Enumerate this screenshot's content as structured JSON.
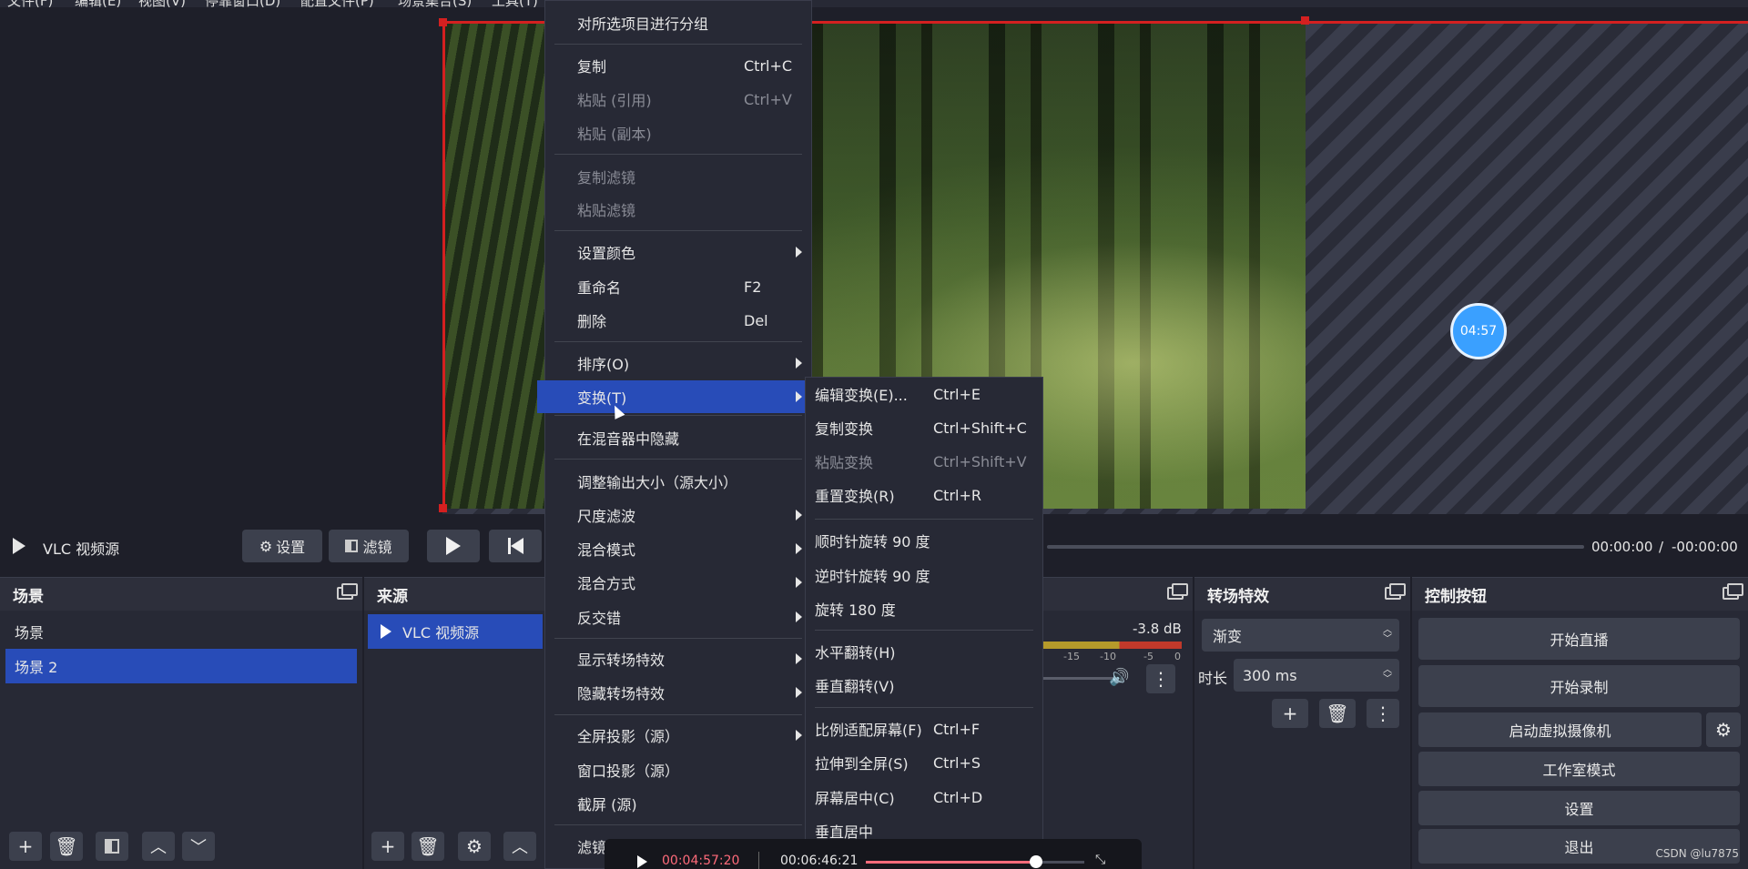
{
  "menubar": [
    "文件(F)",
    "编辑(E)",
    "视图(V)",
    "停靠窗口(D)",
    "配置文件(P)",
    "场景集合(S)",
    "工具(T)"
  ],
  "preview": {
    "timer": "04:57"
  },
  "media_controls": {
    "source_name": "VLC 视频源",
    "settings_label": "设置",
    "filters_label": "滤镜",
    "time_current": "00:00:00",
    "time_separator": "/",
    "time_remaining": "-00:00:00"
  },
  "scenes": {
    "title": "场景",
    "items": [
      "场景",
      "场景 2"
    ],
    "selected_index": 1
  },
  "sources": {
    "title": "来源",
    "items": [
      "VLC 视频源"
    ]
  },
  "mixer": {
    "db": "-3.8 dB",
    "ticks": [
      "-15",
      "-10",
      "-5",
      "0"
    ]
  },
  "transitions": {
    "title": "转场特效",
    "type": "渐变",
    "duration_label": "时长",
    "duration_value": "300 ms"
  },
  "controls": {
    "title": "控制按钮",
    "start_stream": "开始直播",
    "start_record": "开始录制",
    "virtual_cam": "启动虚拟摄像机",
    "studio_mode": "工作室模式",
    "settings": "设置",
    "exit": "退出"
  },
  "context_menu": {
    "group": "对所选项目进行分组",
    "copy": "复制",
    "copy_sc": "Ctrl+C",
    "paste_ref": "粘贴 (引用)",
    "paste_ref_sc": "Ctrl+V",
    "paste_dup": "粘贴 (副本)",
    "copy_filters": "复制滤镜",
    "paste_filters": "粘贴滤镜",
    "set_color": "设置颜色",
    "rename": "重命名",
    "rename_sc": "F2",
    "delete": "删除",
    "delete_sc": "Del",
    "order": "排序(O)",
    "transform": "变换(T)",
    "hide_in_mixer": "在混音器中隐藏",
    "resize_output": "调整输出大小（源大小）",
    "scale_filter": "尺度滤波",
    "blend_mode": "混合模式",
    "blend_method": "混合方式",
    "deinterlace": "反交错",
    "show_transition": "显示转场特效",
    "hide_transition": "隐藏转场特效",
    "fullscreen_proj": "全屏投影（源）",
    "window_proj": "窗口投影（源）",
    "screenshot": "截屏 (源)",
    "filters": "滤镜"
  },
  "transform_menu": {
    "edit": "编辑变换(E)...",
    "edit_sc": "Ctrl+E",
    "copy": "复制变换",
    "copy_sc": "Ctrl+Shift+C",
    "paste": "粘贴变换",
    "paste_sc": "Ctrl+Shift+V",
    "reset": "重置变换(R)",
    "reset_sc": "Ctrl+R",
    "rot_cw": "顺时针旋转 90 度",
    "rot_ccw": "逆时针旋转 90 度",
    "rot_180": "旋转 180 度",
    "flip_h": "水平翻转(H)",
    "flip_v": "垂直翻转(V)",
    "fit": "比例适配屏幕(F)",
    "fit_sc": "Ctrl+F",
    "stretch": "拉伸到全屏(S)",
    "stretch_sc": "Ctrl+S",
    "center": "屏幕居中(C)",
    "center_sc": "Ctrl+D",
    "center_v": "垂直居中"
  },
  "player": {
    "current": "00:04:57:20",
    "total": "00:06:46:21",
    "progress": 0.78
  },
  "watermark": "CSDN @lu7875"
}
